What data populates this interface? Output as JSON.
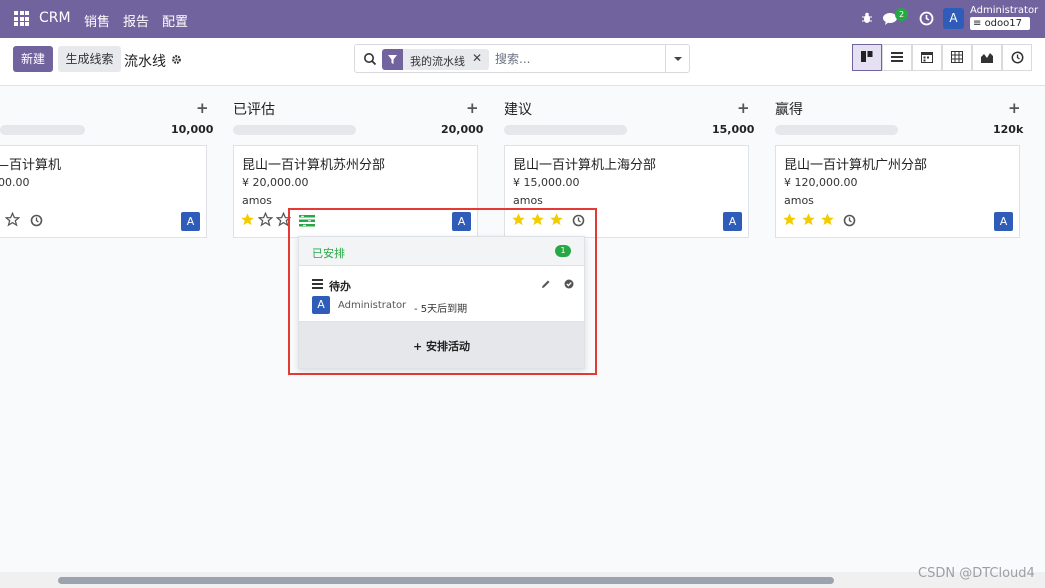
{
  "navbar": {
    "brand": "CRM",
    "menu": [
      "销售",
      "报告",
      "配置"
    ],
    "chat_count": "2",
    "avatar_letter": "A",
    "user_name": "Administrator",
    "db_name": "odoo17"
  },
  "control": {
    "new_label": "新建",
    "generate_label": "生成线索",
    "breadcrumb": "流水线",
    "facet_label": "我的流水线",
    "facet_close": "✕",
    "search_placeholder": "搜索..."
  },
  "columns": [
    {
      "title": "",
      "total": "10,000",
      "progress": 1
    },
    {
      "title": "已评估",
      "total": "20,000",
      "progress": 1
    },
    {
      "title": "建议",
      "total": "15,000",
      "progress": 1
    },
    {
      "title": "赢得",
      "total": "120k",
      "progress": 1
    }
  ],
  "cards": [
    {
      "title": "—百计算机",
      "revenue": "00.00",
      "customer": "",
      "stars": 0
    },
    {
      "title": "昆山一百计算机苏州分部",
      "revenue": "¥ 20,000.00",
      "customer": "amos",
      "stars": 1
    },
    {
      "title": "昆山一百计算机上海分部",
      "revenue": "¥ 15,000.00",
      "customer": "amos",
      "stars": 3
    },
    {
      "title": "昆山一百计算机广州分部",
      "revenue": "¥ 120,000.00",
      "customer": "amos",
      "stars": 3
    }
  ],
  "card_avatar_letter": "A",
  "popover": {
    "header": "已安排",
    "count": "1",
    "activity_type": "待办",
    "avatar_letter": "A",
    "user": "Administrator",
    "due": "- 5天后到期",
    "schedule_label": "安排活动"
  },
  "colors": {
    "brand": "#71639e",
    "avatar": "#2e5cb8",
    "success": "#28a745",
    "star": "#f3cc00",
    "highlight": "#e53935"
  },
  "watermark": "CSDN @DTCloud4"
}
